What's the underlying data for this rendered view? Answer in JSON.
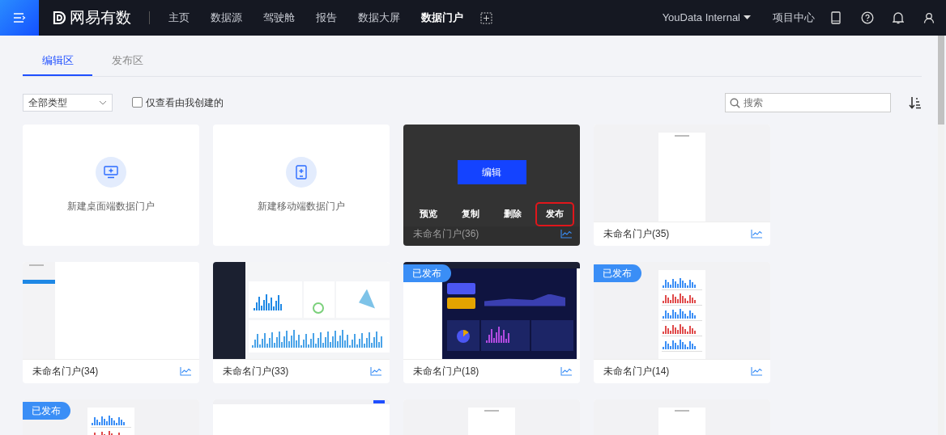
{
  "brand": "网易有数",
  "nav_items": [
    {
      "label": "主页",
      "selected": false
    },
    {
      "label": "数据源",
      "selected": false
    },
    {
      "label": "驾驶舱",
      "selected": false
    },
    {
      "label": "报告",
      "selected": false
    },
    {
      "label": "数据大屏",
      "selected": false
    },
    {
      "label": "数据门户",
      "selected": true
    }
  ],
  "workspace": "YouData Internal",
  "project_center": "项目中心",
  "tabs": [
    {
      "label": "编辑区",
      "selected": true
    },
    {
      "label": "发布区",
      "selected": false
    }
  ],
  "filter": {
    "type_select": "全部类型",
    "mine_only": {
      "label": "仅查看由我创建的",
      "checked": false
    }
  },
  "search": {
    "placeholder": "搜索"
  },
  "cards": [
    {
      "kind": "create",
      "icon": {
        "kind": "desktop"
      },
      "label": "新建桌面端数据门户"
    },
    {
      "kind": "create",
      "icon": {
        "kind": "mobile"
      },
      "label": "新建移动端数据门户"
    },
    {
      "kind": "portal",
      "name": "未命名门户(36)",
      "overlay": {
        "primary": "编辑",
        "actions": [
          {
            "label": "预览",
            "highlighted": false
          },
          {
            "label": "复制",
            "highlighted": false
          },
          {
            "label": "删除",
            "highlighted": false
          },
          {
            "label": "发布",
            "highlighted": true
          }
        ]
      }
    },
    {
      "kind": "portal",
      "name": "未命名门户(35)",
      "preview": {
        "kind": "mobile"
      }
    },
    {
      "kind": "portal",
      "name": "未命名门户(34)",
      "preview": {
        "kind": "sidebar"
      }
    },
    {
      "kind": "portal",
      "name": "未命名门户(33)",
      "preview": {
        "kind": "dashboard"
      }
    },
    {
      "kind": "portal",
      "name": "未命名门户(18)",
      "preview": {
        "kind": "screen"
      },
      "badge": "已发布"
    },
    {
      "kind": "portal",
      "name": "未命名门户(14)",
      "preview": {
        "kind": "report"
      },
      "badge": "已发布"
    },
    {
      "kind": "portal",
      "preview": {
        "kind": "report"
      },
      "badge": "已发布"
    },
    {
      "kind": "portal",
      "preview": {
        "kind": "header"
      }
    },
    {
      "kind": "portal",
      "preview": {
        "kind": "mobile"
      }
    },
    {
      "kind": "portal",
      "preview": {
        "kind": "mobile"
      }
    }
  ]
}
